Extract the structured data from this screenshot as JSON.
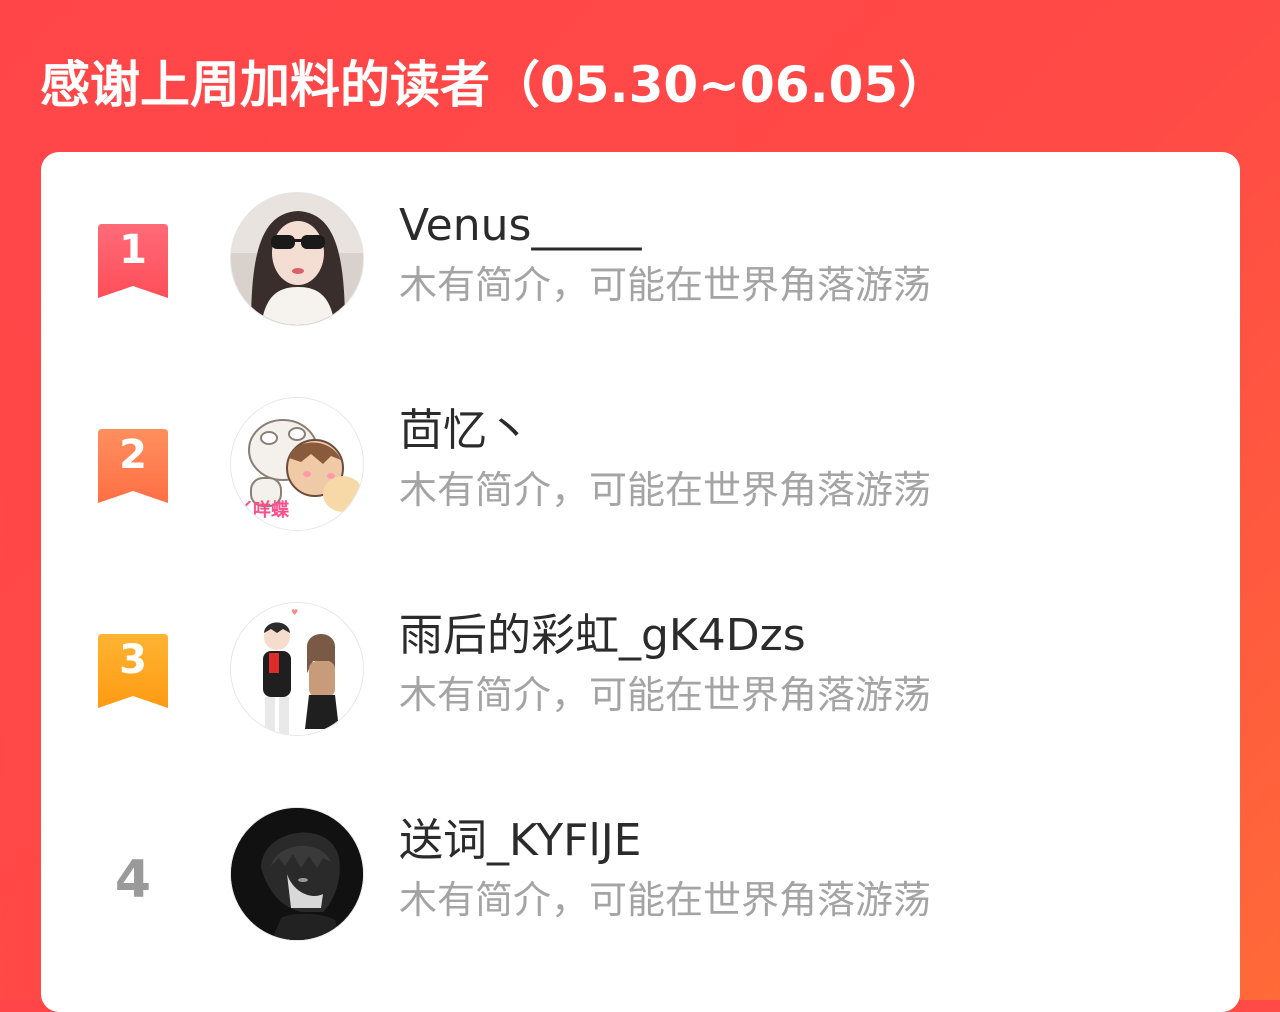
{
  "header": {
    "title": "感谢上周加料的读者（05.30~06.05）"
  },
  "colors": {
    "background": "#ff4548",
    "rank1": "#ff5a66",
    "rank2": "#ff7a4a",
    "rank3": "#ffa21f",
    "name_text": "#2b2b2b",
    "bio_text": "#a4a4a4"
  },
  "readers": [
    {
      "rank": "1",
      "name": "Venus_____",
      "bio": "木有简介，可能在世界角落游荡",
      "avatar_icon": "girl-sunglasses-avatar"
    },
    {
      "rank": "2",
      "name": "茴忆丶",
      "bio": "木有简介，可能在世界角落游荡",
      "avatar_icon": "cartoon-characters-avatar",
      "avatar_text": "丫咩蝶"
    },
    {
      "rank": "3",
      "name": "雨后的彩虹_gK4Dzs",
      "bio": "木有简介，可能在世界角落游荡",
      "avatar_icon": "couple-illustration-avatar"
    },
    {
      "rank": "4",
      "name": "送词_KYFlJE",
      "bio": "木有简介，可能在世界角落游荡",
      "avatar_icon": "dark-anime-boy-avatar"
    }
  ]
}
